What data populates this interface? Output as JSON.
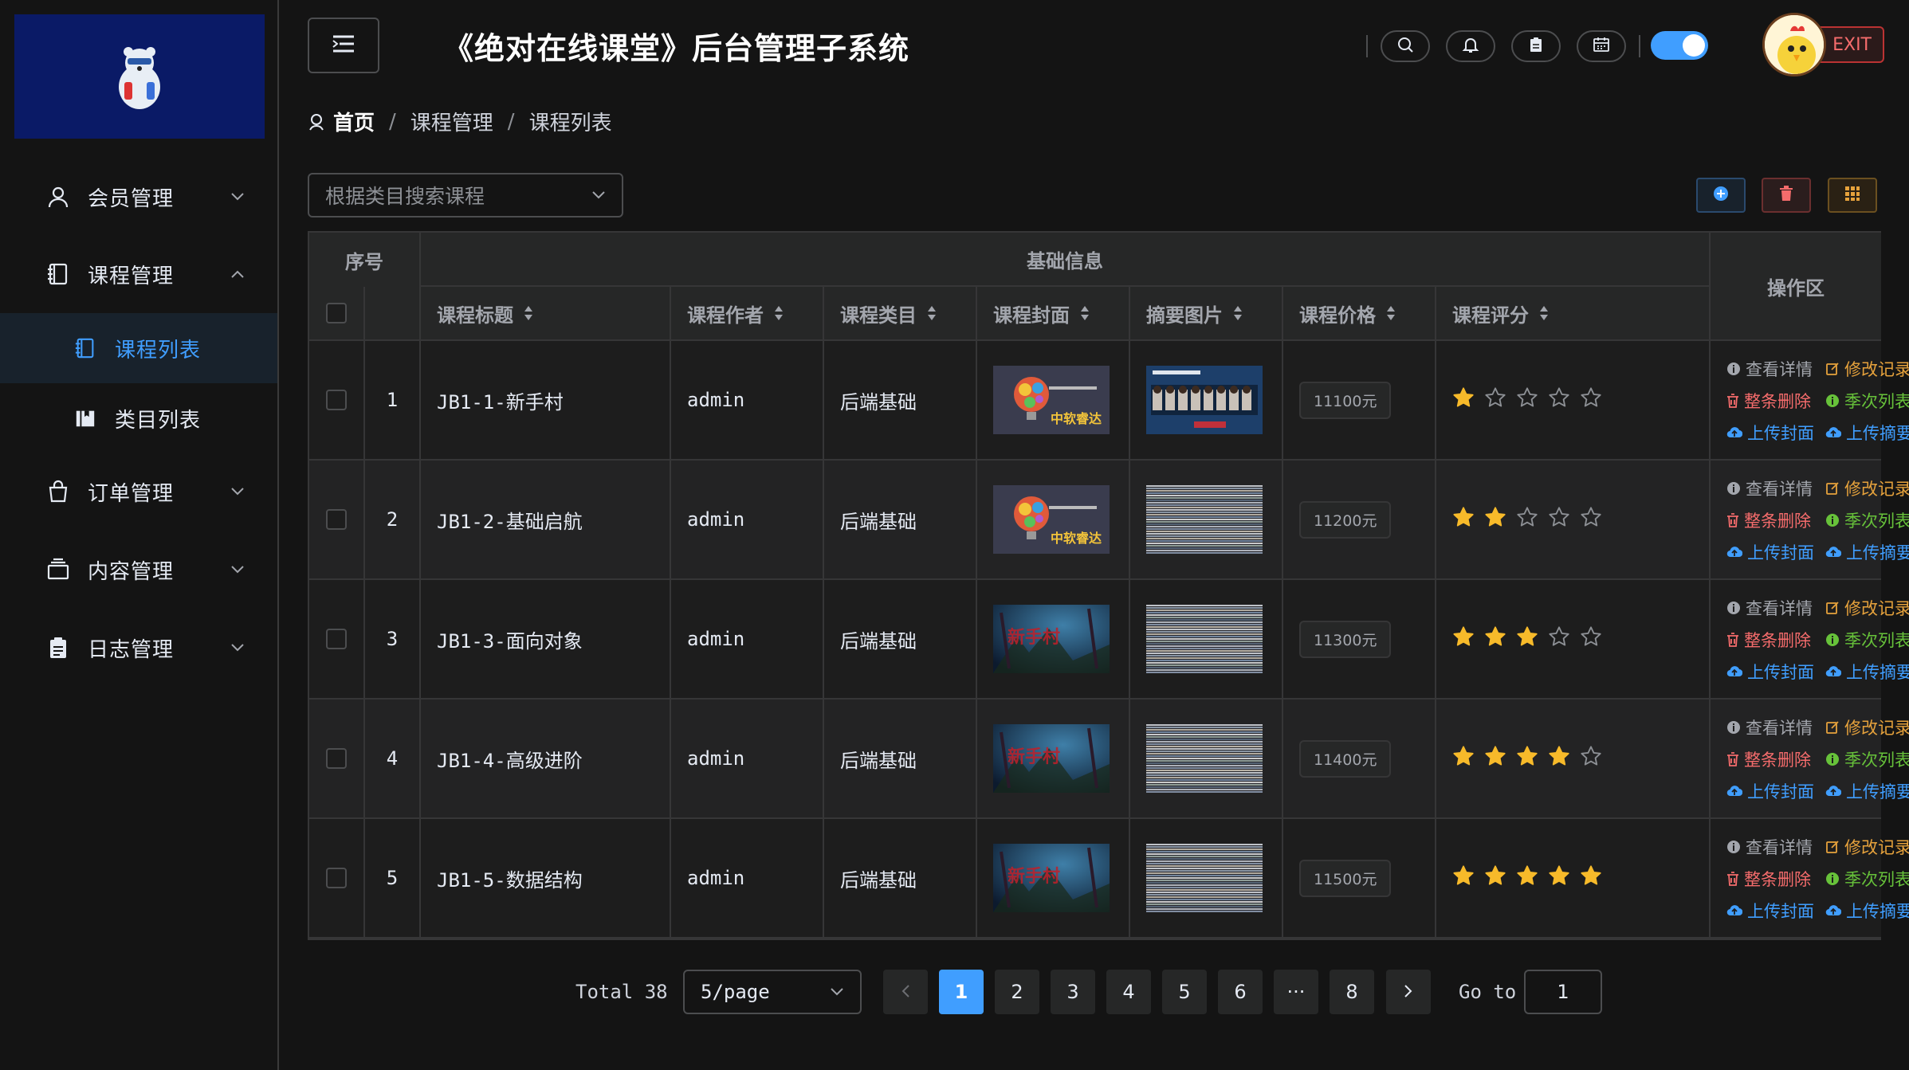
{
  "app": {
    "title": "《绝对在线课堂》后台管理子系统",
    "exit_label": "EXIT"
  },
  "sidebar": {
    "items": [
      {
        "label": "会员管理",
        "icon": "user-icon",
        "expanded": false
      },
      {
        "label": "课程管理",
        "icon": "notebook-icon",
        "expanded": true
      },
      {
        "label": "订单管理",
        "icon": "shopping-bag-icon",
        "expanded": false
      },
      {
        "label": "内容管理",
        "icon": "inbox-icon",
        "expanded": false
      },
      {
        "label": "日志管理",
        "icon": "clipboard-icon",
        "expanded": false
      }
    ],
    "subitems": [
      {
        "label": "课程列表",
        "icon": "notebook-icon",
        "active": true
      },
      {
        "label": "类目列表",
        "icon": "collection-icon",
        "active": false
      }
    ]
  },
  "breadcrumb": {
    "home": "首页",
    "items": [
      "课程管理",
      "课程列表"
    ],
    "separator": "/"
  },
  "search": {
    "placeholder": "根据类目搜索课程"
  },
  "table": {
    "group_headers": {
      "index": "序号",
      "basic": "基础信息",
      "ops": "操作区"
    },
    "columns": [
      "课程标题",
      "课程作者",
      "课程类目",
      "课程封面",
      "摘要图片",
      "课程价格",
      "课程评分"
    ],
    "rows": [
      {
        "index": "1",
        "title": "JB1-1-新手村",
        "author": "admin",
        "category": "后端基础",
        "price": "11100元",
        "rating": 1,
        "cover": "bulb",
        "summary": "slides"
      },
      {
        "index": "2",
        "title": "JB1-2-基础启航",
        "author": "admin",
        "category": "后端基础",
        "price": "11200元",
        "rating": 2,
        "cover": "bulb",
        "summary": "glitch"
      },
      {
        "index": "3",
        "title": "JB1-3-面向对象",
        "author": "admin",
        "category": "后端基础",
        "price": "11300元",
        "rating": 3,
        "cover": "night",
        "summary": "glitch"
      },
      {
        "index": "4",
        "title": "JB1-4-高级进阶",
        "author": "admin",
        "category": "后端基础",
        "price": "11400元",
        "rating": 4,
        "cover": "night",
        "summary": "glitch"
      },
      {
        "index": "5",
        "title": "JB1-5-数据结构",
        "author": "admin",
        "category": "后端基础",
        "price": "11500元",
        "rating": 5,
        "cover": "night",
        "summary": "glitch"
      }
    ],
    "operations": {
      "view": "查看详情",
      "edit": "修改记录",
      "delete": "整条删除",
      "seasons": "季次列表",
      "upload_cover": "上传封面",
      "upload_summary": "上传摘要"
    },
    "cover_text": {
      "bulb": "中软睿达",
      "night": "新手村"
    }
  },
  "pagination": {
    "total_label": "Total 38",
    "page_size": "5/page",
    "pages": [
      "1",
      "2",
      "3",
      "4",
      "5",
      "6",
      "···",
      "8"
    ],
    "current": "1",
    "goto_label": "Go to",
    "goto_value": "1"
  },
  "colors": {
    "accent": "#409eff",
    "danger": "#f56c6c",
    "success": "#67c23a",
    "warning": "#e6a23c",
    "star": "#f7ba2a"
  }
}
